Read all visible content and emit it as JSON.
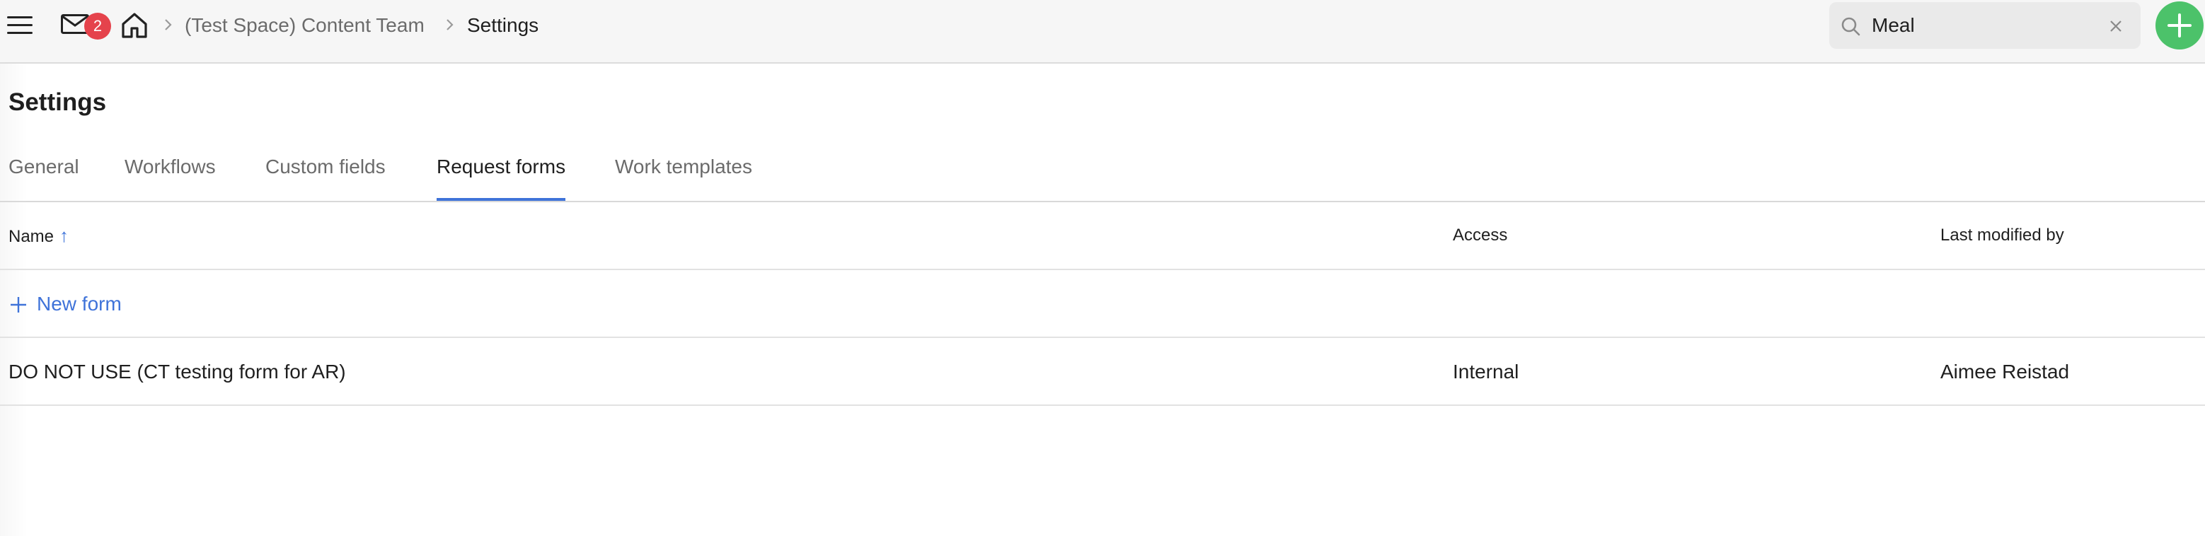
{
  "header": {
    "menu_icon": "hamburger-menu-icon",
    "inbox_icon": "mail-icon",
    "inbox_badge": "2",
    "home_icon": "home-icon",
    "breadcrumb": [
      {
        "label": "(Test Space) Content Team"
      },
      {
        "label": "Settings"
      }
    ],
    "search": {
      "icon": "search-icon",
      "value": "Meal",
      "clear_icon": "close-icon"
    },
    "add_button_icon": "plus-icon",
    "colors": {
      "badge": "#e5434c",
      "add_button": "#4cc26a"
    }
  },
  "page": {
    "title": "Settings"
  },
  "tabs": [
    {
      "label": "General",
      "active": false
    },
    {
      "label": "Workflows",
      "active": false
    },
    {
      "label": "Custom fields",
      "active": false
    },
    {
      "label": "Request forms",
      "active": true
    },
    {
      "label": "Work templates",
      "active": false
    }
  ],
  "table": {
    "columns": [
      {
        "label": "Name",
        "sort": "ascending",
        "sort_icon": "arrow-up-icon"
      },
      {
        "label": "Access"
      },
      {
        "label": "Last modified by"
      }
    ],
    "new_form_label": "New form",
    "rows": [
      {
        "name": "DO NOT USE (CT testing form for AR)",
        "access": "Internal",
        "last_modified_by": "Aimee Reistad"
      }
    ]
  },
  "accent_color": "#3f73d9"
}
